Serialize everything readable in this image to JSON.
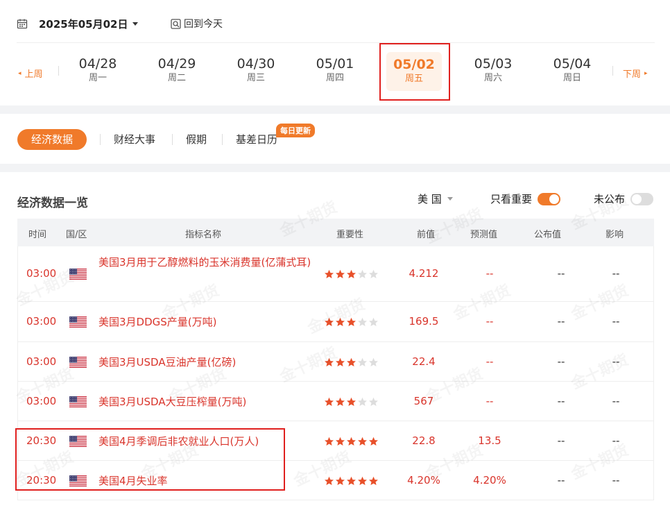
{
  "header": {
    "date_title": "2025年05月02日",
    "today_label": "回到今天",
    "prev_week": "上周",
    "next_week": "下周",
    "days": [
      {
        "date": "04/28",
        "weekday": "周一",
        "active": false
      },
      {
        "date": "04/29",
        "weekday": "周二",
        "active": false
      },
      {
        "date": "04/30",
        "weekday": "周三",
        "active": false
      },
      {
        "date": "05/01",
        "weekday": "周四",
        "active": false
      },
      {
        "date": "05/02",
        "weekday": "周五",
        "active": true
      },
      {
        "date": "05/03",
        "weekday": "周六",
        "active": false
      },
      {
        "date": "05/04",
        "weekday": "周日",
        "active": false
      }
    ]
  },
  "tabs": {
    "items": [
      "经济数据",
      "财经大事",
      "假期",
      "基差日历"
    ],
    "badge": "每日更新"
  },
  "panel": {
    "title": "经济数据一览",
    "country": "美 国",
    "important_only_label": "只看重要",
    "important_only": true,
    "unpublished_label": "未公布",
    "unpublished": false,
    "columns": [
      "时间",
      "国/区",
      "指标名称",
      "重要性",
      "前值",
      "预测值",
      "公布值",
      "影响"
    ],
    "rows": [
      {
        "time": "03:00",
        "country_flag": "us-flag-icon",
        "name": "美国3月用于乙醇燃料的玉米消费量(亿蒲式耳)",
        "stars": 3,
        "prev": "4.212",
        "forecast": "--",
        "actual": "--",
        "impact": "--"
      },
      {
        "time": "03:00",
        "country_flag": "us-flag-icon",
        "name": "美国3月DDGS产量(万吨)",
        "stars": 3,
        "prev": "169.5",
        "forecast": "--",
        "actual": "--",
        "impact": "--"
      },
      {
        "time": "03:00",
        "country_flag": "us-flag-icon",
        "name": "美国3月USDA豆油产量(亿磅)",
        "stars": 3,
        "prev": "22.4",
        "forecast": "--",
        "actual": "--",
        "impact": "--"
      },
      {
        "time": "03:00",
        "country_flag": "us-flag-icon",
        "name": "美国3月USDA大豆压榨量(万吨)",
        "stars": 3,
        "prev": "567",
        "forecast": "--",
        "actual": "--",
        "impact": "--"
      },
      {
        "time": "20:30",
        "country_flag": "us-flag-icon",
        "name": "美国4月季调后非农就业人口(万人)",
        "stars": 5,
        "prev": "22.8",
        "forecast": "13.5",
        "actual": "--",
        "impact": "--"
      },
      {
        "time": "20:30",
        "country_flag": "us-flag-icon",
        "name": "美国4月失业率",
        "stars": 5,
        "prev": "4.20%",
        "forecast": "4.20%",
        "actual": "--",
        "impact": "--"
      }
    ],
    "watermark": "金十期货"
  },
  "colors": {
    "accent": "#f07a2a",
    "value_red": "#d9342b",
    "highlight_box": "#e0201e",
    "star_on": "#e8502a",
    "star_off": "#dddddd"
  }
}
